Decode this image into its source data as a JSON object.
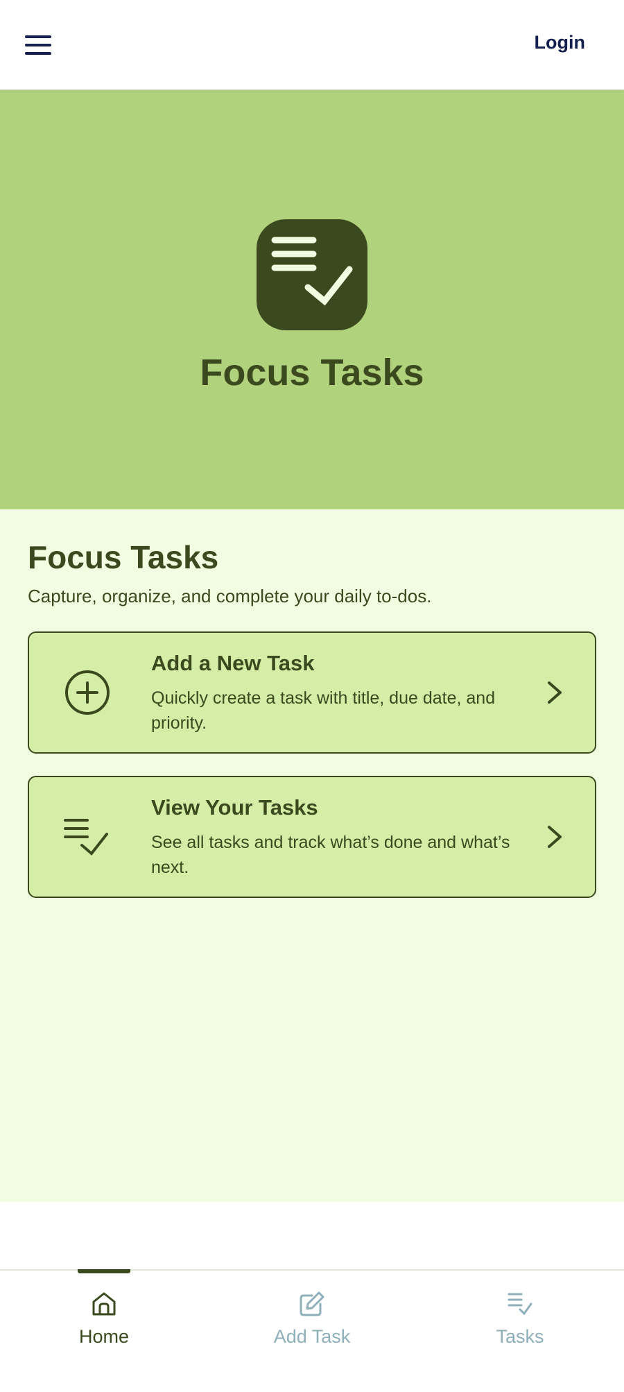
{
  "header": {
    "menu_icon": "hamburger-menu-icon",
    "login_label": "Login"
  },
  "hero": {
    "logo_icon": "checklist-icon",
    "title": "Focus Tasks"
  },
  "main": {
    "title": "Focus Tasks",
    "subtitle": "Capture, organize, and complete your daily to-dos.",
    "cards": [
      {
        "icon": "plus-circle-icon",
        "title": "Add a New Task",
        "description": "Quickly create a task with title, due date, and priority."
      },
      {
        "icon": "checklist-icon",
        "title": "View Your Tasks",
        "description": "See all tasks and track what’s done and what’s next."
      }
    ]
  },
  "bottom_nav": {
    "items": [
      {
        "label": "Home",
        "icon": "home-icon",
        "active": true
      },
      {
        "label": "Add Task",
        "icon": "edit-icon",
        "active": false
      },
      {
        "label": "Tasks",
        "icon": "checklist-icon",
        "active": false
      }
    ]
  },
  "colors": {
    "hero_bg": "#b1d27d",
    "main_bg": "#f1fde0",
    "card_bg": "#d4eda7",
    "primary_dark": "#3b4a1e",
    "nav_inactive": "#8fb0ba",
    "header_text": "#14204f"
  }
}
